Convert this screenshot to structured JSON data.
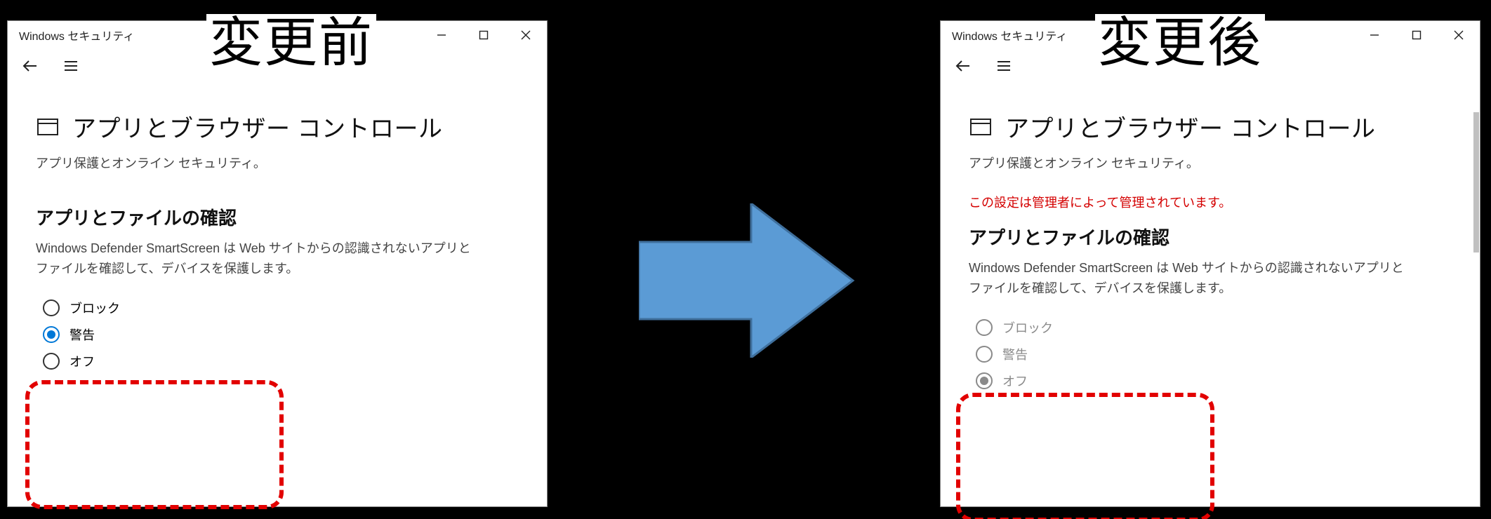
{
  "annotations": {
    "before": "変更前",
    "after": "変更後"
  },
  "window": {
    "title": "Windows セキュリティ",
    "heading": "アプリとブラウザー コントロール",
    "subtitle": "アプリ保護とオンライン セキュリティ。",
    "section_title": "アプリとファイルの確認",
    "section_desc": "Windows Defender SmartScreen は Web サイトからの認識されないアプリとファイルを確認して、デバイスを保護します。",
    "admin_msg": "この設定は管理者によって管理されています。",
    "options": {
      "block": "ブロック",
      "warn": "警告",
      "off": "オフ"
    }
  },
  "before_state": {
    "selected": "warn",
    "disabled": false,
    "show_admin": false
  },
  "after_state": {
    "selected": "off",
    "disabled": true,
    "show_admin": true
  }
}
